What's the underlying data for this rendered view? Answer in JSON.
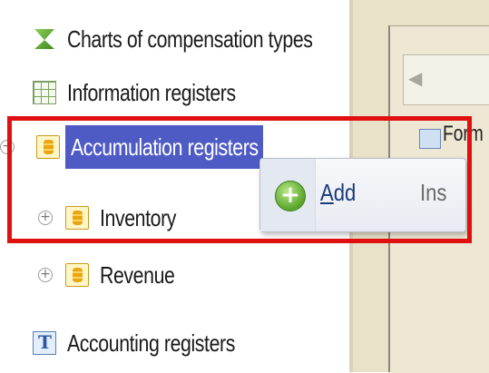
{
  "tree": {
    "top_cut_text": "",
    "items": [
      {
        "label": "Charts of compensation types",
        "icon": "chart-icon"
      },
      {
        "label": "Information registers",
        "icon": "information-register-icon"
      },
      {
        "label": "Accumulation registers",
        "icon": "accumulation-register-icon",
        "expander": "−"
      },
      {
        "label": "Inventory",
        "icon": "accumulation-register-icon",
        "expander": "+"
      },
      {
        "label": "Revenue",
        "icon": "accumulation-register-icon",
        "expander": "+"
      },
      {
        "label": "Accounting registers",
        "icon": "accounting-register-icon"
      }
    ]
  },
  "right_panel": {
    "tab_label": "Form",
    "scroll_left_glyph": "◀"
  },
  "context_menu": {
    "add_label_prefix": "A",
    "add_label_rest": "dd",
    "add_shortcut": "Ins",
    "add_icon_glyph": "+"
  },
  "colors": {
    "selection": "#4f5bc4",
    "highlight_box": "#e01010"
  }
}
